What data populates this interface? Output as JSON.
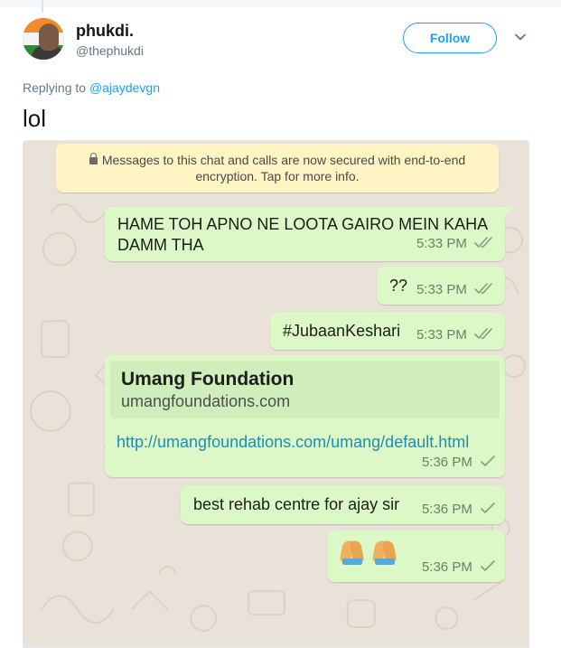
{
  "tweet": {
    "author_name": "phukdi.",
    "author_handle": "@thephukdi",
    "follow_label": "Follow",
    "replying_prefix": "Replying to",
    "replying_to": "@ajaydevgn",
    "text": "lol"
  },
  "chat": {
    "system_message_line1": "Messages to this chat and calls are now secured with end-to-end",
    "system_message_line2": "encryption. Tap for more info.",
    "messages": [
      {
        "text": "HAME TOH APNO NE LOOTA GAIRO MEIN KAHA DAMM THA",
        "time": "5:33 PM",
        "status": "read"
      },
      {
        "text": "??",
        "time": "5:33 PM",
        "status": "read"
      },
      {
        "text": "#JubaanKeshari",
        "time": "5:33 PM",
        "status": "read"
      },
      {
        "preview_title": "Umang Foundation",
        "preview_domain": "umangfoundations.com",
        "text": "http://umangfoundations.com/umang/default.html",
        "time": "5:36 PM",
        "status": "sent"
      },
      {
        "text": "best rehab centre for ajay sir",
        "time": "5:36 PM",
        "status": "sent"
      },
      {
        "emoji": [
          "folded-hands",
          "folded-hands"
        ],
        "time": "5:36 PM",
        "status": "sent"
      }
    ]
  },
  "colors": {
    "twitter_blue": "#1da1f2",
    "bubble_green": "#dcf8c6",
    "chat_background": "#e9e2d8",
    "system_yellow": "#fff5c4",
    "read_tick": "#8a9a85"
  }
}
